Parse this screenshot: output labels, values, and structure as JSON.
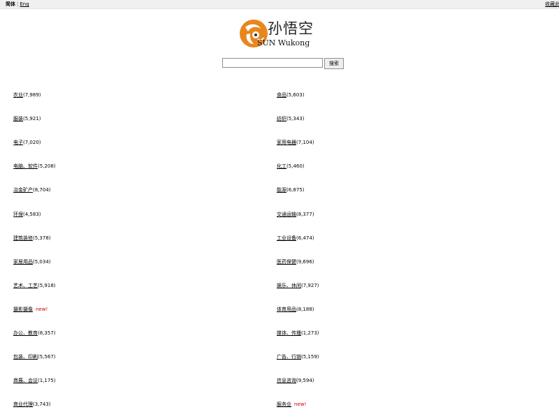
{
  "topbar": {
    "current_lang": "简体",
    "separator": "|",
    "alt_lang": "Eng",
    "bookmark": "收藏此"
  },
  "logo": {
    "text_cn": "孙悟空",
    "text_en": "SUN Wukong",
    "colors": {
      "primary": "#e8871e",
      "dark": "#3a2a1a"
    }
  },
  "search": {
    "placeholder": "",
    "button_label": "搜索"
  },
  "categories": {
    "left": [
      {
        "name": "农业",
        "count": "(7,989)",
        "new": ""
      },
      {
        "name": "服装",
        "count": "(5,921)",
        "new": ""
      },
      {
        "name": "电子",
        "count": "(7,020)",
        "new": ""
      },
      {
        "name": "电脑、软件",
        "count": "(5,208)",
        "new": ""
      },
      {
        "name": "冶金矿产",
        "count": "(8,704)",
        "new": ""
      },
      {
        "name": "环保",
        "count": "(4,583)",
        "new": ""
      },
      {
        "name": "建筑装修",
        "count": "(5,378)",
        "new": ""
      },
      {
        "name": "家居用品",
        "count": "(5,034)",
        "new": ""
      },
      {
        "name": "艺术、工艺",
        "count": "(5,918)",
        "new": ""
      },
      {
        "name": "摄影摄像",
        "count": "",
        "new": "new!"
      },
      {
        "name": "办公、教育",
        "count": "(8,357)",
        "new": ""
      },
      {
        "name": "包装、印刷",
        "count": "(5,567)",
        "new": ""
      },
      {
        "name": "商展、会议",
        "count": "(1,175)",
        "new": ""
      },
      {
        "name": "商业代理",
        "count": "(3,743)",
        "new": ""
      }
    ],
    "right": [
      {
        "name": "食品",
        "count": "(5,603)",
        "new": ""
      },
      {
        "name": "纺织",
        "count": "(5,343)",
        "new": ""
      },
      {
        "name": "家用电器",
        "count": "(7,104)",
        "new": ""
      },
      {
        "name": "化工",
        "count": "(5,460)",
        "new": ""
      },
      {
        "name": "能源",
        "count": "(6,875)",
        "new": ""
      },
      {
        "name": "交通运输",
        "count": "(8,377)",
        "new": ""
      },
      {
        "name": "工业设备",
        "count": "(6,474)",
        "new": ""
      },
      {
        "name": "医药保健",
        "count": "(9,696)",
        "new": ""
      },
      {
        "name": "娱乐、休闲",
        "count": "(7,927)",
        "new": ""
      },
      {
        "name": "体育用品",
        "count": "(8,188)",
        "new": ""
      },
      {
        "name": "媒体、传播",
        "count": "(1,273)",
        "new": ""
      },
      {
        "name": "广告、行销",
        "count": "(5,159)",
        "new": ""
      },
      {
        "name": "信息咨询",
        "count": "(9,594)",
        "new": ""
      },
      {
        "name": "服务业",
        "count": "",
        "new": "new!"
      }
    ]
  }
}
